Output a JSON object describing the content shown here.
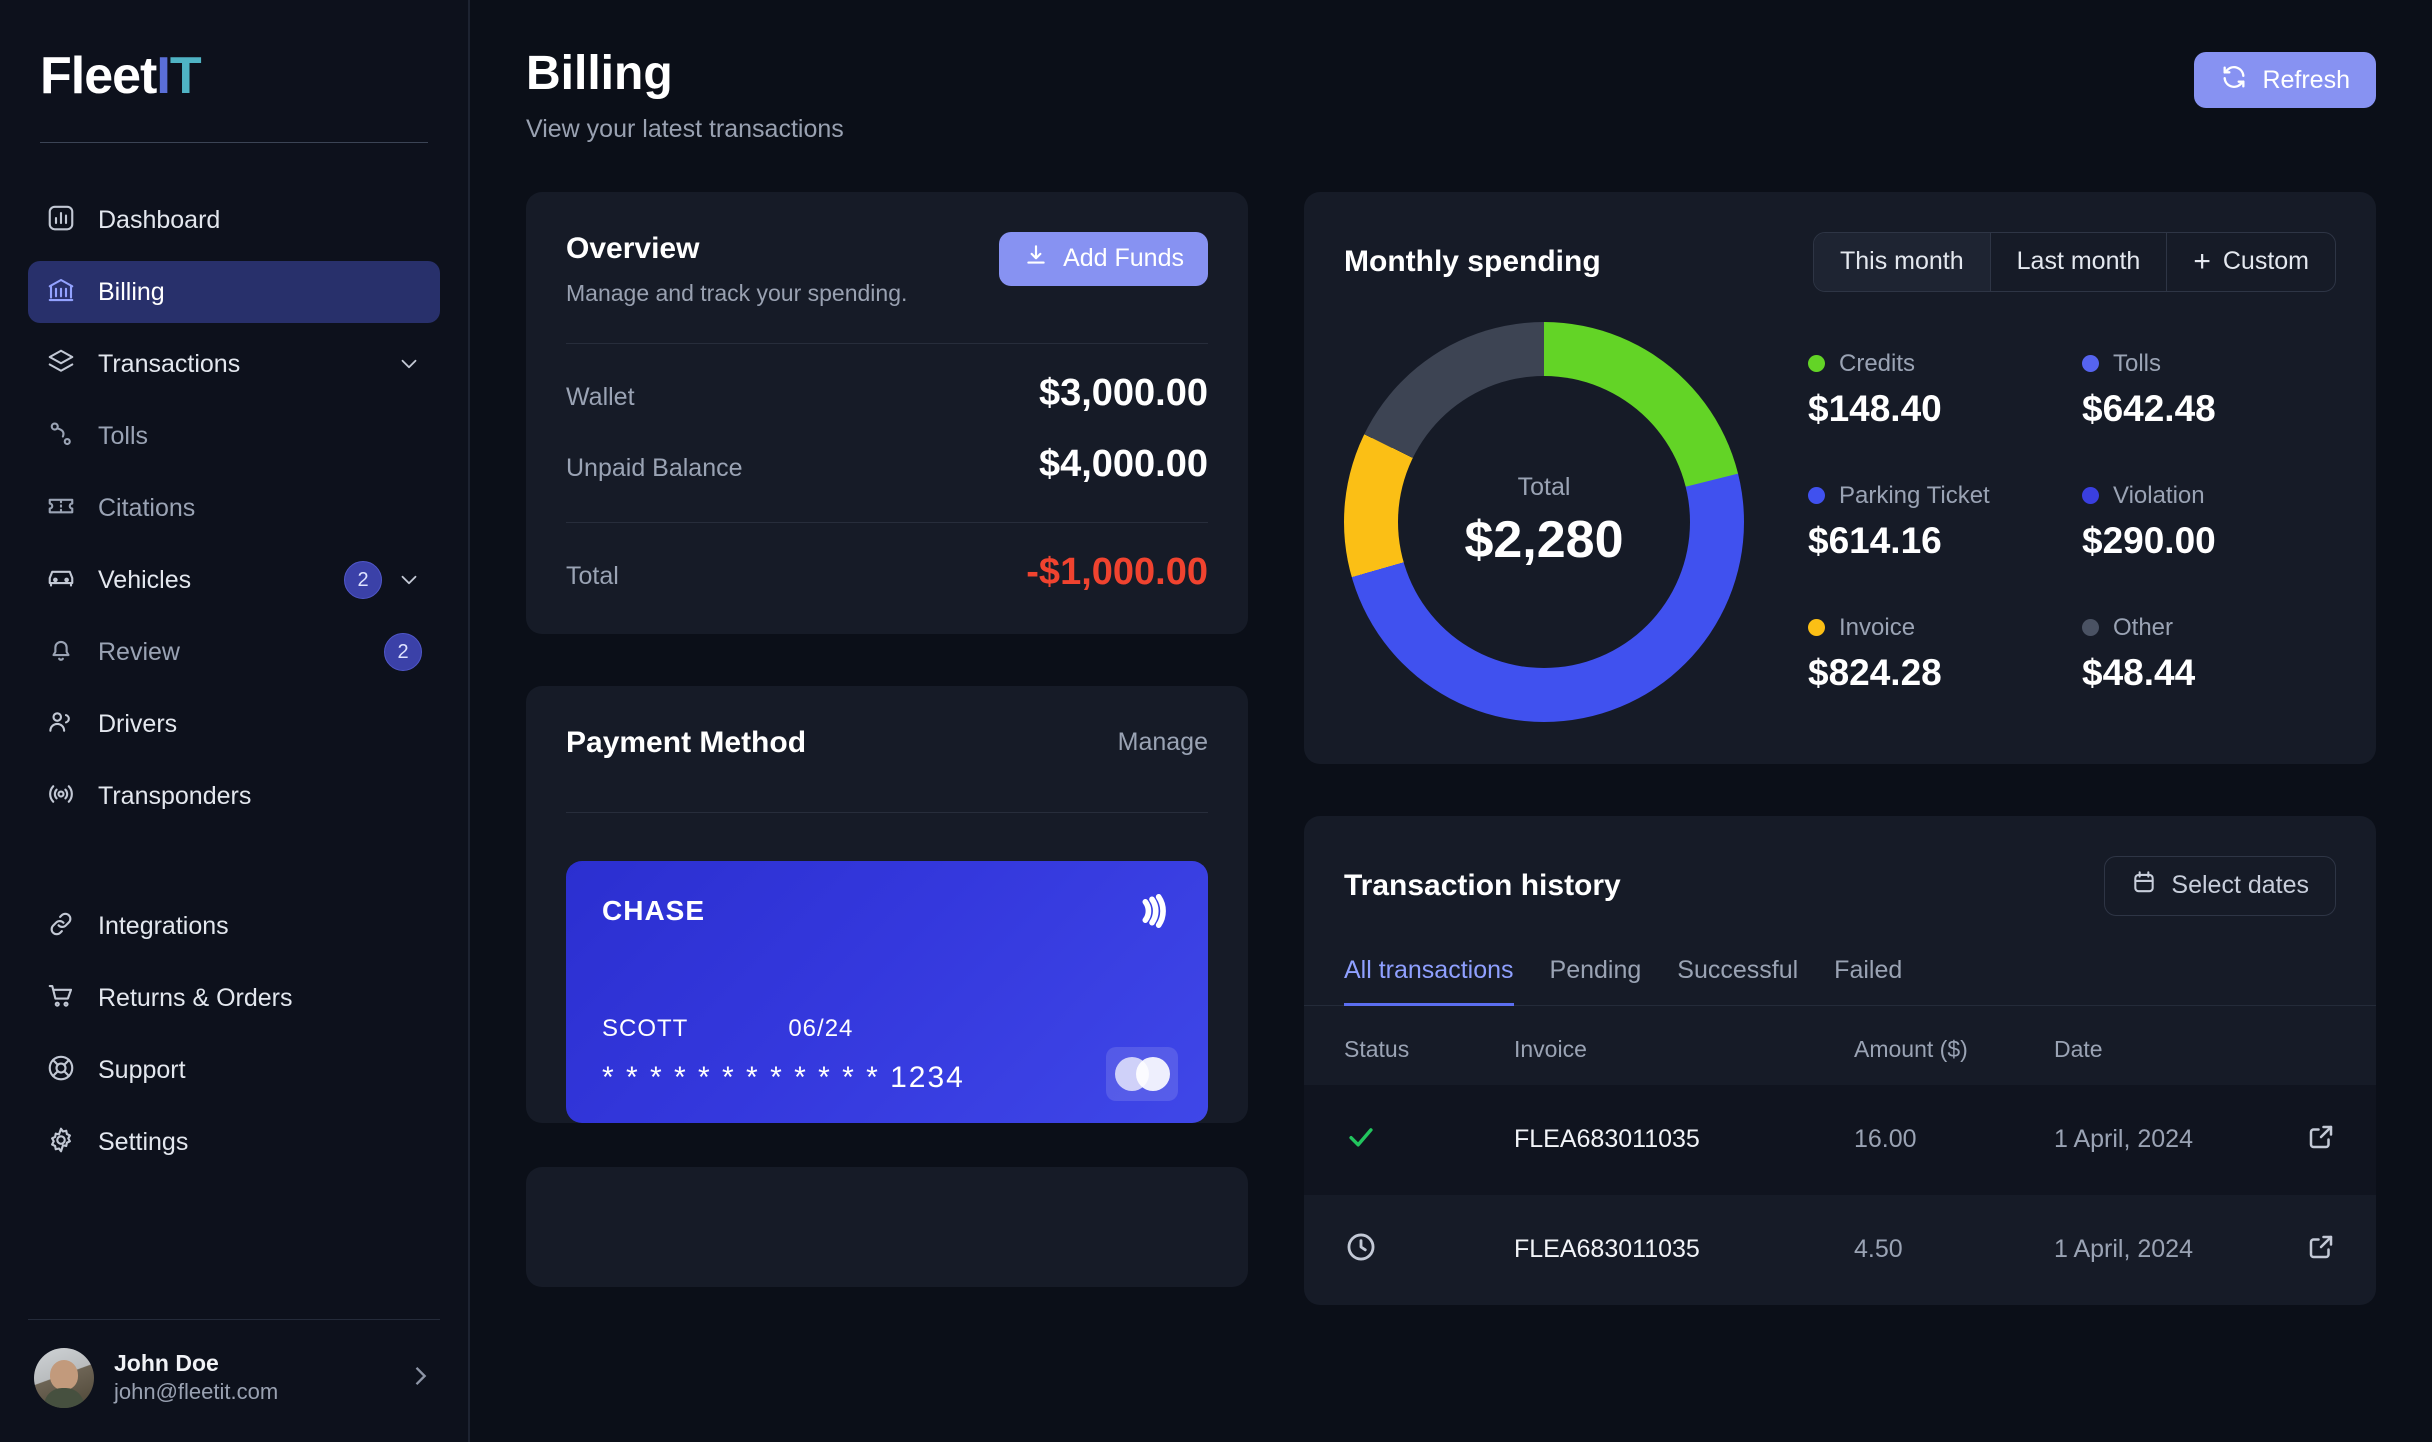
{
  "brand": {
    "part1": "Fleet",
    "part2": "I",
    "part3": "T"
  },
  "sidebar": {
    "items": [
      {
        "label": "Dashboard",
        "icon": "chart-bar-icon"
      },
      {
        "label": "Billing",
        "icon": "bank-icon"
      },
      {
        "label": "Transactions",
        "icon": "layers-icon"
      },
      {
        "label": "Tolls",
        "icon": "route-icon"
      },
      {
        "label": "Citations",
        "icon": "ticket-icon"
      },
      {
        "label": "Vehicles",
        "icon": "car-icon",
        "badge": "2"
      },
      {
        "label": "Review",
        "icon": "bell-icon",
        "badge": "2"
      },
      {
        "label": "Drivers",
        "icon": "users-icon"
      },
      {
        "label": "Transponders",
        "icon": "signal-icon"
      },
      {
        "label": "Integrations",
        "icon": "link-icon"
      },
      {
        "label": "Returns & Orders",
        "icon": "cart-icon"
      },
      {
        "label": "Support",
        "icon": "lifebuoy-icon"
      },
      {
        "label": "Settings",
        "icon": "gear-icon"
      }
    ],
    "profile": {
      "name": "John Doe",
      "email": "john@fleetit.com"
    }
  },
  "header": {
    "title": "Billing",
    "subtitle": "View your latest transactions",
    "refresh_label": "Refresh"
  },
  "overview": {
    "title": "Overview",
    "subtitle": "Manage and track your spending.",
    "add_funds_label": "Add Funds",
    "rows": [
      {
        "label": "Wallet",
        "value": "$3,000.00"
      },
      {
        "label": "Unpaid Balance",
        "value": "$4,000.00"
      }
    ],
    "total_label": "Total",
    "total_value": "-$1,000.00"
  },
  "payment_method": {
    "title": "Payment Method",
    "manage_label": "Manage",
    "card": {
      "brand": "CHASE",
      "holder": "SCOTT",
      "expiry": "06/24",
      "number": "* * * *  * * * *  * * * *  1234"
    }
  },
  "monthly_spending": {
    "title": "Monthly spending",
    "ranges": [
      {
        "label": "This month",
        "active": true
      },
      {
        "label": "Last month",
        "active": false
      },
      {
        "label": "Custom",
        "active": false,
        "icon": "plus-icon"
      }
    ],
    "center_label": "Total",
    "center_value": "$2,280"
  },
  "transaction_history": {
    "title": "Transaction history",
    "select_dates_label": "Select dates",
    "tabs": [
      {
        "label": "All transactions",
        "active": true
      },
      {
        "label": "Pending",
        "active": false
      },
      {
        "label": "Successful",
        "active": false
      },
      {
        "label": "Failed",
        "active": false
      }
    ],
    "columns": [
      "Status",
      "Invoice",
      "Amount ($)",
      "Date"
    ],
    "rows": [
      {
        "status": "successful",
        "invoice": "FLEA683011035",
        "amount": "16.00",
        "date": "1 April, 2024"
      },
      {
        "status": "pending",
        "invoice": "FLEA683011035",
        "amount": "4.50",
        "date": "1 April, 2024"
      }
    ]
  },
  "chart_data": {
    "type": "pie",
    "title": "Monthly spending",
    "total_label": "Total",
    "total": 2280,
    "categories": [
      "Credits",
      "Tolls",
      "Parking Ticket",
      "Violation",
      "Invoice",
      "Other"
    ],
    "values": [
      148.4,
      642.48,
      614.16,
      290.0,
      824.28,
      48.44
    ],
    "labels": [
      "$148.40",
      "$642.48",
      "$614.16",
      "$290.00",
      "$824.28",
      "$48.44"
    ],
    "colors": [
      "#63d426",
      "#4051ef",
      "#4051ef",
      "#3a3fe0",
      "#fbbf15",
      "#4a5263"
    ],
    "segments": [
      {
        "name": "Credits",
        "color": "#63d426",
        "start_deg": 0,
        "end_deg": 76
      },
      {
        "name": "Tolls",
        "color": "#4051ef",
        "start_deg": 76,
        "end_deg": 254
      },
      {
        "name": "Invoice",
        "color": "#fbbf15",
        "start_deg": 254,
        "end_deg": 296
      },
      {
        "name": "Other",
        "color": "#3d4453",
        "start_deg": 296,
        "end_deg": 360
      }
    ],
    "legend_position": "right",
    "grid": false
  },
  "colors": {
    "accent": "#8792f2",
    "accent_tab": "#8fa0ff",
    "negative": "#f0432f",
    "background": "#0b0f18",
    "card": "#161b27",
    "sidebar": "#0d111c",
    "active_nav": "#28306b",
    "green": "#63d426",
    "blue": "#4051ef",
    "yellow": "#fbbf15",
    "gray": "#3d4453",
    "success": "#22c55e"
  }
}
